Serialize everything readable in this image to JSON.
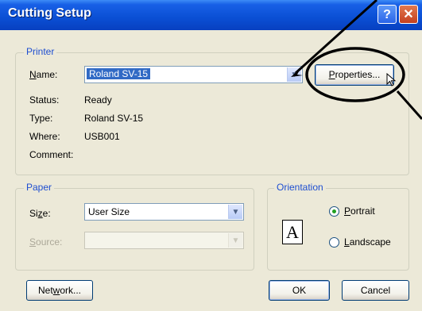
{
  "dialog": {
    "title": "Cutting Setup",
    "help_glyph": "?",
    "close_glyph": "✕"
  },
  "printer": {
    "legend": "Printer",
    "name_label": "Name:",
    "name_value": "Roland SV-15",
    "properties_button": "Properties...",
    "status_label": "Status:",
    "status_value": "Ready",
    "type_label": "Type:",
    "type_value": "Roland SV-15",
    "where_label": "Where:",
    "where_value": "USB001",
    "comment_label": "Comment:",
    "comment_value": ""
  },
  "paper": {
    "legend": "Paper",
    "size_label": "Size:",
    "size_value": "User Size",
    "source_label": "Source:",
    "source_value": ""
  },
  "orientation": {
    "legend": "Orientation",
    "icon_letter": "A",
    "portrait_label": "Portrait",
    "landscape_label": "Landscape",
    "selected": "Portrait"
  },
  "buttons": {
    "network": "Network...",
    "ok": "OK",
    "cancel": "Cancel"
  },
  "colors": {
    "titlebar": "#0a4fd4",
    "dialog_bg": "#ece9d8",
    "legend_text": "#1f4fd1",
    "selection": "#316ac5",
    "annotation": "#000000"
  }
}
